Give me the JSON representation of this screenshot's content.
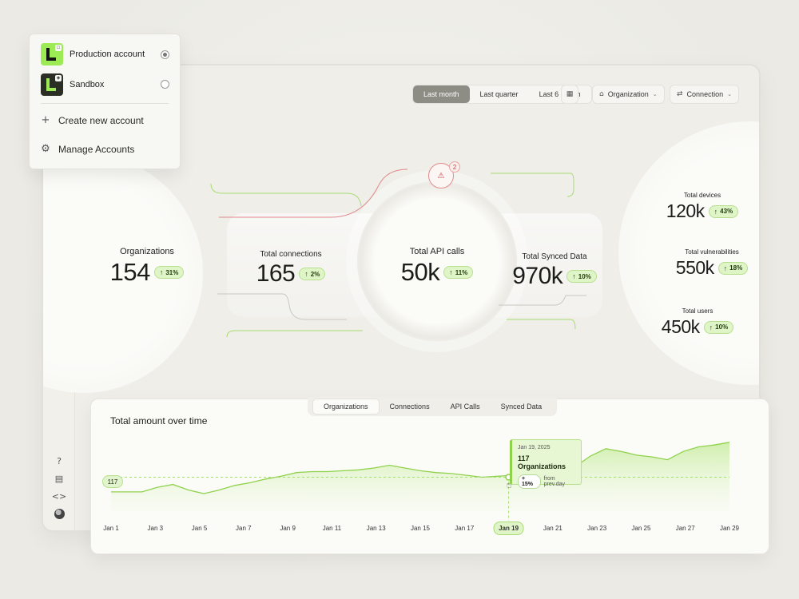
{
  "toolbar": {
    "periods": [
      "Last month",
      "Last quarter",
      "Last 6 month"
    ],
    "active_period": "Last month",
    "calendar_icon": "calendar-icon",
    "organization_label": "Organization",
    "connection_label": "Connection"
  },
  "accounts": {
    "items": [
      {
        "label": "Production account",
        "selected": true
      },
      {
        "label": "Sandbox",
        "selected": false
      }
    ],
    "create_label": "Create new account",
    "manage_label": "Manage Accounts"
  },
  "metrics": {
    "organizations": {
      "label": "Organizations",
      "value": "154",
      "change": "31%"
    },
    "connections": {
      "label": "Total connections",
      "value": "165",
      "change": "2%"
    },
    "api_calls": {
      "label": "Total API calls",
      "value": "50k",
      "change": "11%"
    },
    "synced": {
      "label": "Total Synced Data",
      "value": "970k",
      "change": "10%"
    },
    "devices": {
      "label": "Total devices",
      "value": "120k",
      "change": "43%"
    },
    "vulnerabilities": {
      "label": "Total vulnerabilities",
      "value": "550k",
      "change": "18%"
    },
    "users": {
      "label": "Total users",
      "value": "450k",
      "change": "10%"
    }
  },
  "alert": {
    "count": "2"
  },
  "rail_icons": [
    "help-icon",
    "document-icon",
    "code-icon",
    "avatar"
  ],
  "panel": {
    "title": "Total amount over time",
    "tabs": [
      "Organizations",
      "Connections",
      "API Calls",
      "Synced Data"
    ],
    "active_tab": "Organizations"
  },
  "tooltip": {
    "date": "Jan 19, 2025",
    "title": "117 Organizations",
    "change": "+ 15%",
    "change_suffix": "from prev.day"
  },
  "y_marker": "117",
  "colors": {
    "accent": "#9ceb55",
    "line": "#8fd24c",
    "alert": "#d95c5c"
  },
  "chart_data": {
    "type": "area",
    "x": [
      "Jan 1",
      "Jan 2",
      "Jan 3",
      "Jan 4",
      "Jan 5",
      "Jan 6",
      "Jan 7",
      "Jan 8",
      "Jan 9",
      "Jan 10",
      "Jan 11",
      "Jan 12",
      "Jan 13",
      "Jan 14",
      "Jan 15",
      "Jan 16",
      "Jan 17",
      "Jan 18",
      "Jan 19",
      "Jan 20",
      "Jan 21",
      "Jan 22",
      "Jan 23",
      "Jan 24",
      "Jan 25",
      "Jan 26",
      "Jan 27",
      "Jan 28",
      "Jan 29"
    ],
    "x_tick_labels": [
      "Jan 1",
      "Jan 3",
      "Jan 5",
      "Jan 7",
      "Jan 9",
      "Jan 11",
      "Jan 13",
      "Jan 15",
      "Jan 17",
      "Jan 19",
      "Jan 21",
      "Jan 23",
      "Jan 25",
      "Jan 27",
      "Jan 29"
    ],
    "highlight_x": "Jan 19",
    "reference_value": 117,
    "series": [
      {
        "values": [
          101,
          101,
          101,
          106,
          109,
          103,
          99,
          103,
          108,
          111,
          115,
          118,
          122,
          123,
          123,
          124,
          125,
          127,
          130,
          127,
          124,
          122,
          121,
          119,
          117,
          118,
          119,
          118,
          120,
          122,
          128,
          140,
          148,
          145,
          141,
          139,
          136,
          145,
          150,
          152,
          155
        ]
      }
    ],
    "ylim": [
      80,
      160
    ]
  }
}
